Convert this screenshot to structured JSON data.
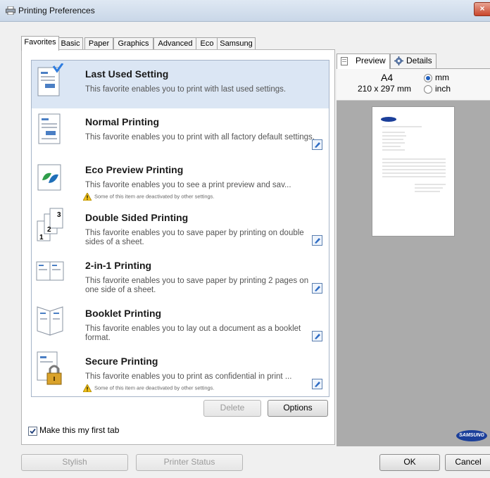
{
  "window": {
    "title": "Printing Preferences",
    "close_label": "×"
  },
  "tabs": [
    "Favorites",
    "Basic",
    "Paper",
    "Graphics",
    "Advanced",
    "Eco",
    "Samsung"
  ],
  "favorites": [
    {
      "title": "Last Used Setting",
      "desc": "This favorite enables you to print with last used settings.",
      "warning": "",
      "editable": false
    },
    {
      "title": "Normal Printing",
      "desc": "This favorite enables you to print with all factory default settings.",
      "warning": "",
      "editable": true
    },
    {
      "title": "Eco Preview Printing",
      "desc": "This favorite enables you to see a print preview and sav...",
      "warning": "Some of this item are deactivated by other settings.",
      "editable": false
    },
    {
      "title": "Double Sided Printing",
      "desc": "This favorite enables you to save paper by printing on double sides of a sheet.",
      "warning": "",
      "editable": true
    },
    {
      "title": "2-in-1 Printing",
      "desc": "This favorite enables you to save paper by printing 2 pages on one side of a sheet.",
      "warning": "",
      "editable": true
    },
    {
      "title": "Booklet Printing",
      "desc": "This favorite enables you to lay out a document as a booklet format.",
      "warning": "",
      "editable": true
    },
    {
      "title": "Secure Printing",
      "desc": "This favorite enables you to print as confidential in print ...",
      "warning": "Some of this item are deactivated by other settings.",
      "editable": true
    }
  ],
  "buttons": {
    "delete": "Delete",
    "options": "Options",
    "stylish": "Stylish",
    "printer_status": "Printer Status",
    "ok": "OK",
    "cancel": "Cancel"
  },
  "first_tab": {
    "label": "Make this my first tab",
    "checked": true
  },
  "preview": {
    "tabs": [
      "Preview",
      "Details"
    ],
    "paper": "A4",
    "dims": "210 x 297 mm",
    "units": [
      "mm",
      "inch"
    ],
    "selected_unit": "mm",
    "logo": "SAMSUNG"
  },
  "colors": {
    "accent": "#1b3f9a",
    "selected_row": "#dbe6f4",
    "preview_bg": "#ababab"
  }
}
